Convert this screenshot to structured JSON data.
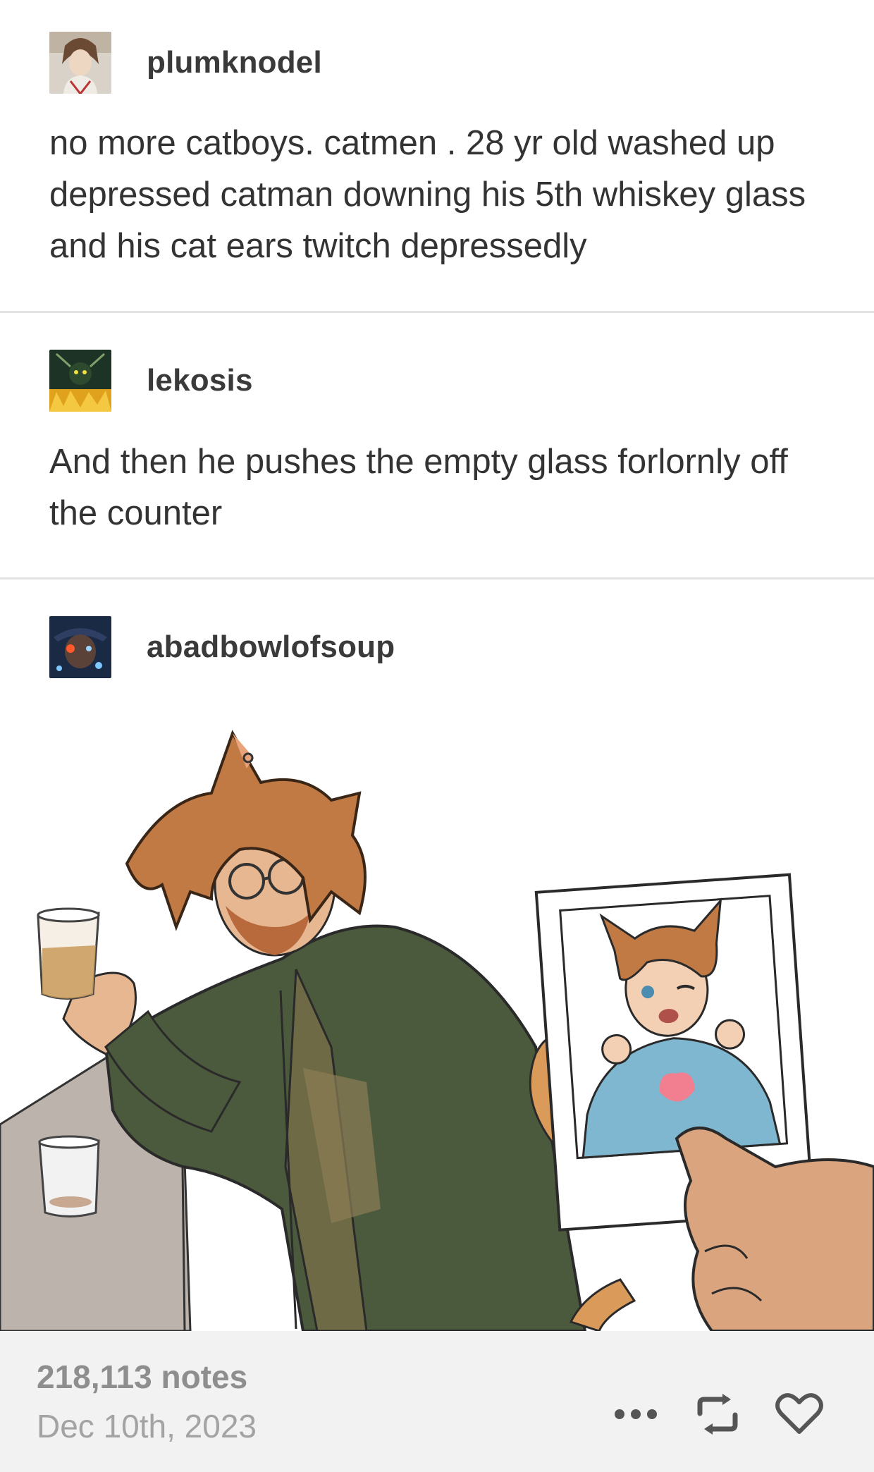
{
  "posts": [
    {
      "username": "plumknodel",
      "avatar_icon": "avatar-plumknodel",
      "text": "no more catboys. catmen . 28 yr old washed up depressed catman downing his 5th whiskey glass and his cat ears twitch depressedly"
    },
    {
      "username": "lekosis",
      "avatar_icon": "avatar-lekosis",
      "text": "And then he pushes the empty glass forlornly off the counter"
    },
    {
      "username": "abadbowlofsoup",
      "avatar_icon": "avatar-abadbowlofsoup",
      "image": "illustration of tired catman at a bar holding whiskey, hand holding polaroid of younger catboy"
    }
  ],
  "footer": {
    "notes": "218,113 notes",
    "date": "Dec 10th, 2023",
    "actions": [
      "more-icon",
      "reblog-icon",
      "heart-icon"
    ]
  },
  "colors": {
    "text": "#333333",
    "muted": "#8e8e8e",
    "divider": "#e3e3e3",
    "footer_bg": "#f2f2f2",
    "jacket": "#4b5a3c",
    "hair": "#c27a45",
    "sweater": "#7fb7d0",
    "heart": "#f27f8f"
  }
}
